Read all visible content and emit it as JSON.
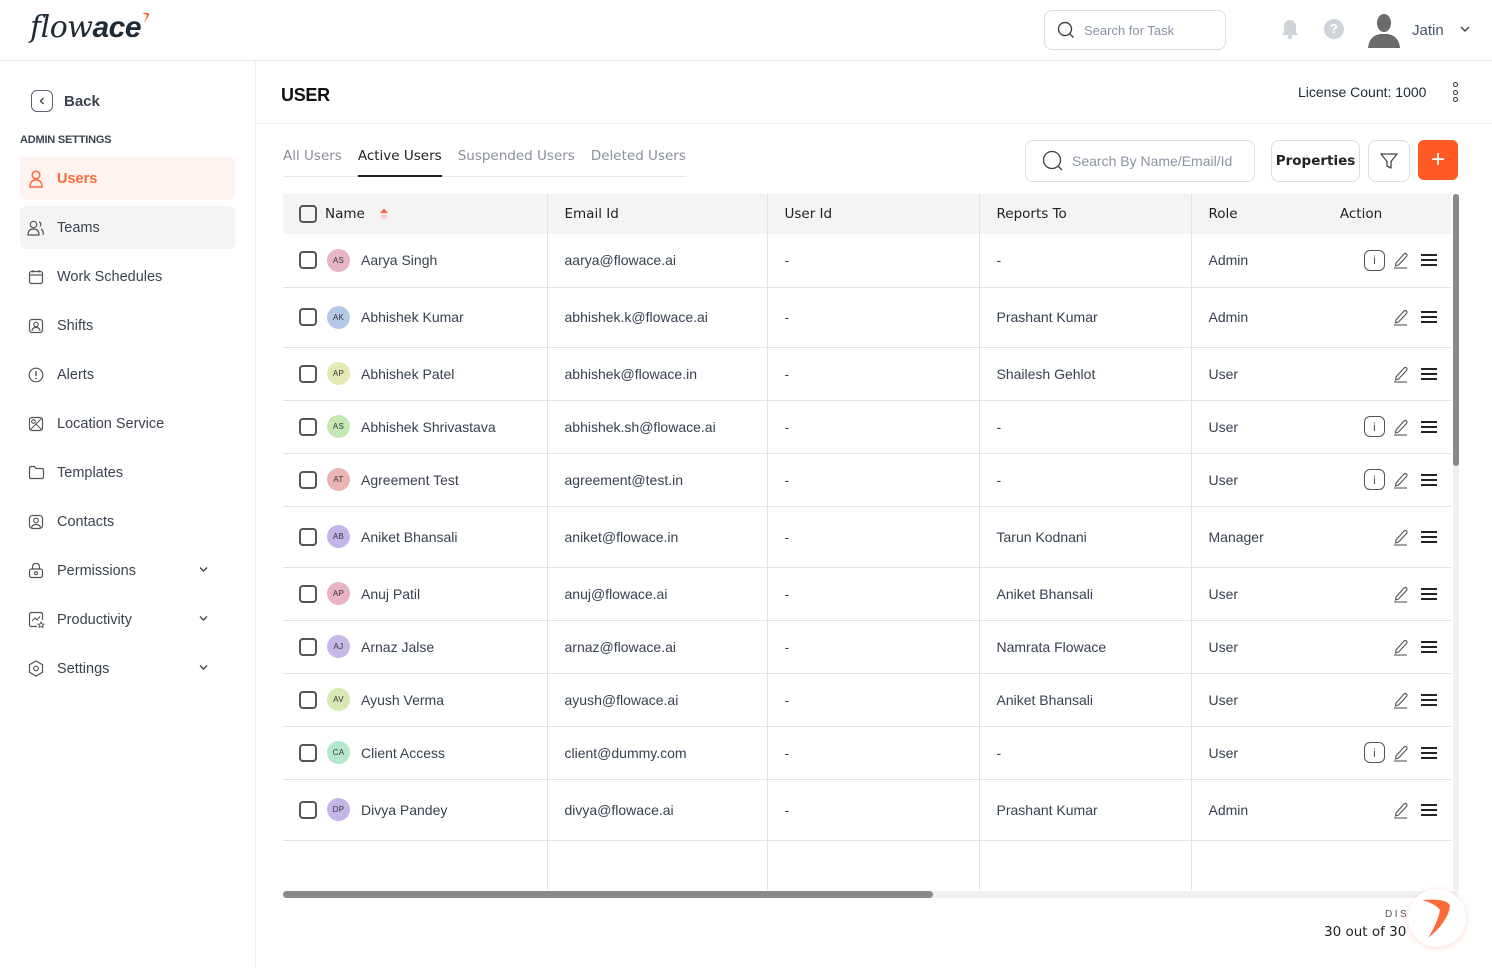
{
  "app": {
    "logo_light": "flow",
    "logo_bold": "ace",
    "brand_color": "#ff5a23"
  },
  "topbar": {
    "search_placeholder": "Search for Task",
    "user_name": "Jatin",
    "icons": [
      "bell-icon",
      "help-icon",
      "user-avatar-icon",
      "chevron-down-icon"
    ]
  },
  "sidebar": {
    "back_label": "Back",
    "section_title": "ADMIN SETTINGS",
    "items": [
      {
        "label": "Users",
        "icon": "user-icon",
        "active": true,
        "expandable": false
      },
      {
        "label": "Teams",
        "icon": "users-icon",
        "active": false,
        "expandable": false
      },
      {
        "label": "Work Schedules",
        "icon": "calendar-icon",
        "active": false,
        "expandable": false
      },
      {
        "label": "Shifts",
        "icon": "badge-icon",
        "active": false,
        "expandable": false
      },
      {
        "label": "Alerts",
        "icon": "alert-circle-icon",
        "active": false,
        "expandable": false
      },
      {
        "label": "Location Service",
        "icon": "location-map-icon",
        "active": false,
        "expandable": false
      },
      {
        "label": "Templates",
        "icon": "folder-icon",
        "active": false,
        "expandable": false
      },
      {
        "label": "Contacts",
        "icon": "contact-icon",
        "active": false,
        "expandable": false
      },
      {
        "label": "Permissions",
        "icon": "lock-icon",
        "active": false,
        "expandable": true
      },
      {
        "label": "Productivity",
        "icon": "productivity-icon",
        "active": false,
        "expandable": true
      },
      {
        "label": "Settings",
        "icon": "settings-icon",
        "active": false,
        "expandable": true
      }
    ]
  },
  "main": {
    "title": "USER",
    "license_count": "License Count: 1000",
    "tabs": [
      {
        "label": "All Users",
        "active": false
      },
      {
        "label": "Active Users",
        "active": true
      },
      {
        "label": "Suspended Users",
        "active": false
      },
      {
        "label": "Deleted Users",
        "active": false
      }
    ],
    "search_placeholder": "Search By Name/Email/Id",
    "properties_label": "Properties",
    "add_label": "+",
    "table": {
      "columns": [
        "Name",
        "Email Id",
        "User Id",
        "Reports To",
        "Role",
        "Action"
      ],
      "rows": [
        {
          "initials": "AS",
          "avatar_color": "#e8b4c8",
          "name": "Aarya Singh",
          "email": "aarya@flowace.ai",
          "user_id": "-",
          "reports_to": "-",
          "role": "Admin",
          "info": true
        },
        {
          "initials": "AK",
          "avatar_color": "#b4c8e8",
          "name": "Abhishek Kumar",
          "email": "abhishek.k@flowace.ai",
          "user_id": "-",
          "reports_to": "Prashant Kumar",
          "role": "Admin",
          "info": false
        },
        {
          "initials": "AP",
          "avatar_color": "#e4e8b4",
          "name": "Abhishek Patel",
          "email": "abhishek@flowace.in",
          "user_id": "-",
          "reports_to": "Shailesh Gehlot",
          "role": "User",
          "info": false
        },
        {
          "initials": "AS",
          "avatar_color": "#c4e8b4",
          "name": "Abhishek Shrivastava",
          "email": "abhishek.sh@flowace.ai",
          "user_id": "-",
          "reports_to": "-",
          "role": "User",
          "info": true
        },
        {
          "initials": "AT",
          "avatar_color": "#e8b4b4",
          "name": "Agreement Test",
          "email": "agreement@test.in",
          "user_id": "-",
          "reports_to": "-",
          "role": "User",
          "info": true
        },
        {
          "initials": "AB",
          "avatar_color": "#c4b4e8",
          "name": "Aniket Bhansali",
          "email": "aniket@flowace.in",
          "user_id": "-",
          "reports_to": "Tarun Kodnani",
          "role": "Manager",
          "info": false
        },
        {
          "initials": "AP",
          "avatar_color": "#e8b4c4",
          "name": "Anuj Patil",
          "email": "anuj@flowace.ai",
          "user_id": "-",
          "reports_to": "Aniket Bhansali",
          "role": "User",
          "info": false
        },
        {
          "initials": "AJ",
          "avatar_color": "#c8b8e8",
          "name": "Arnaz Jalse",
          "email": "arnaz@flowace.ai",
          "user_id": "-",
          "reports_to": "Namrata Flowace",
          "role": "User",
          "info": false
        },
        {
          "initials": "AV",
          "avatar_color": "#d8e8b4",
          "name": "Ayush Verma",
          "email": "ayush@flowace.ai",
          "user_id": "-",
          "reports_to": "Aniket Bhansali",
          "role": "User",
          "info": false
        },
        {
          "initials": "CA",
          "avatar_color": "#b4e8cc",
          "name": "Client Access",
          "email": "client@dummy.com",
          "user_id": "-",
          "reports_to": "-",
          "role": "User",
          "info": true
        },
        {
          "initials": "DP",
          "avatar_color": "#c4b4e8",
          "name": "Divya Pandey",
          "email": "divya@flowace.ai",
          "user_id": "-",
          "reports_to": "Prashant Kumar",
          "role": "Admin",
          "info": false
        }
      ]
    },
    "display_label": "DISI",
    "display_count": "30 out of 30"
  }
}
